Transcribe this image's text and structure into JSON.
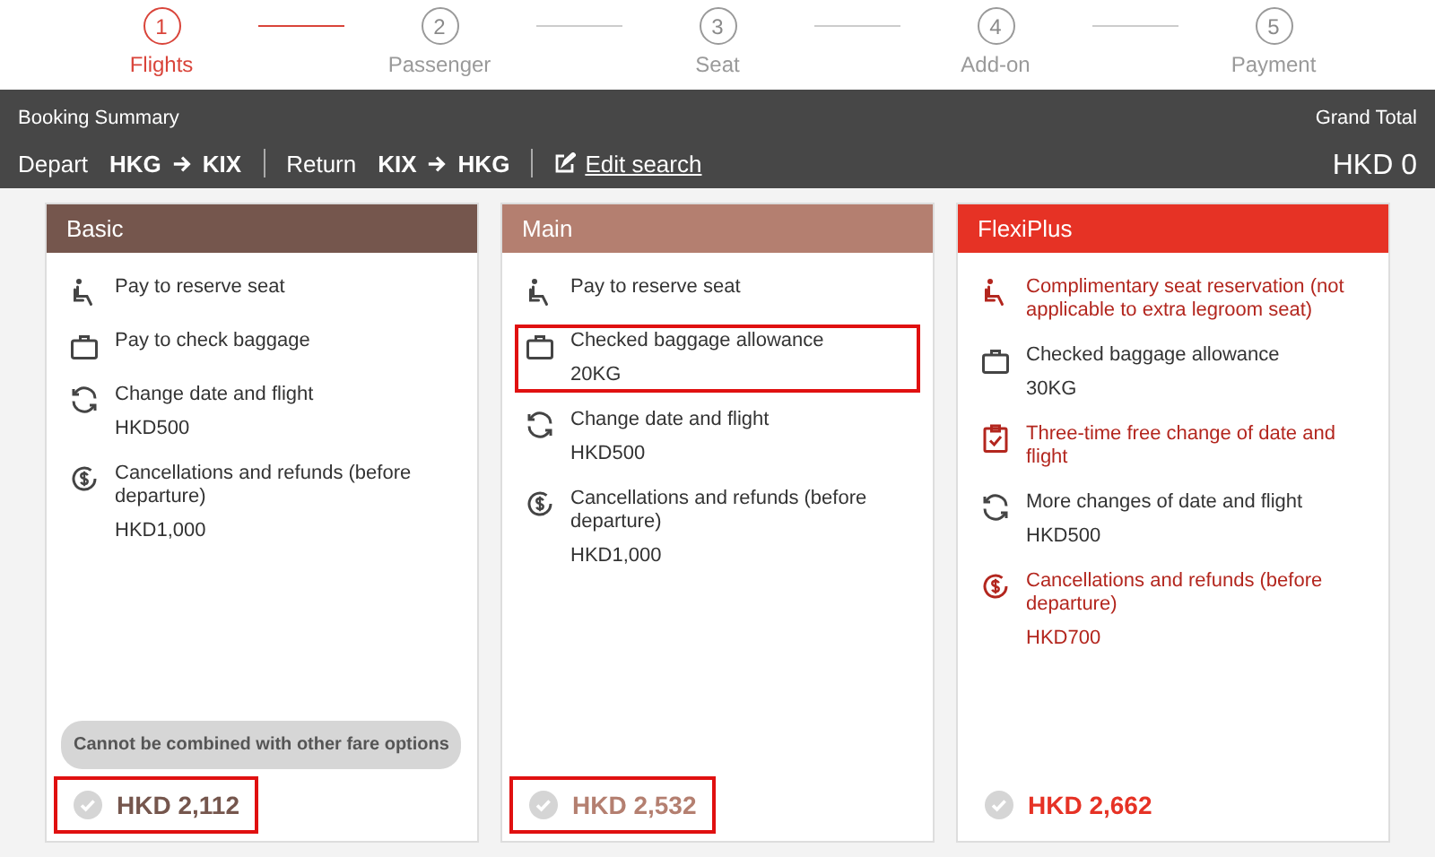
{
  "steps": [
    {
      "number": "1",
      "label": "Flights",
      "selected": true
    },
    {
      "number": "2",
      "label": "Passenger",
      "selected": false
    },
    {
      "number": "3",
      "label": "Seat",
      "selected": false
    },
    {
      "number": "4",
      "label": "Add-on",
      "selected": false
    },
    {
      "number": "5",
      "label": "Payment",
      "selected": false
    }
  ],
  "summary": {
    "title": "Booking Summary",
    "depart_label": "Depart",
    "depart_from": "HKG",
    "depart_to": "KIX",
    "return_label": "Return",
    "return_from": "KIX",
    "return_to": "HKG",
    "edit_link": "Edit search",
    "total_label": "Grand Total",
    "total_value": "HKD 0"
  },
  "fares": [
    {
      "name": "Basic",
      "color": "#75564d",
      "features": [
        {
          "kind": "seat",
          "text": "Pay to reserve seat",
          "emphasized": false,
          "highlighted": false
        },
        {
          "kind": "bag",
          "text": "Pay to check baggage",
          "emphasized": false,
          "highlighted": false
        },
        {
          "kind": "refresh",
          "text": "Change date and flight",
          "detail": "HKD500",
          "emphasized": false,
          "highlighted": false
        },
        {
          "kind": "dollar",
          "text": "Cancellations and refunds (before departure)",
          "detail": "HKD1,000",
          "emphasized": false,
          "highlighted": false
        }
      ],
      "note": "Cannot be combined with other fare options",
      "price": "HKD 2,112",
      "price_highlighted": true
    },
    {
      "name": "Main",
      "color": "#b47f70",
      "features": [
        {
          "kind": "seat",
          "text": "Pay to reserve seat",
          "emphasized": false,
          "highlighted": false
        },
        {
          "kind": "bag",
          "text": "Checked baggage allowance",
          "detail": "20KG",
          "emphasized": false,
          "highlighted": true
        },
        {
          "kind": "refresh",
          "text": "Change date and flight",
          "detail": "HKD500",
          "emphasized": false,
          "highlighted": false
        },
        {
          "kind": "dollar",
          "text": "Cancellations and refunds (before departure)",
          "detail": "HKD1,000",
          "emphasized": false,
          "highlighted": false
        }
      ],
      "price": "HKD 2,532",
      "price_highlighted": true
    },
    {
      "name": "FlexiPlus",
      "color": "#e63225",
      "features": [
        {
          "kind": "seat",
          "text": "Complimentary seat reservation (not applicable to extra legroom seat)",
          "emphasized": true,
          "highlighted": false
        },
        {
          "kind": "bag",
          "text": "Checked baggage allowance",
          "detail": "30KG",
          "emphasized": false,
          "highlighted": false
        },
        {
          "kind": "clipboard",
          "text": "Three-time free change of date and flight",
          "emphasized": true,
          "highlighted": false
        },
        {
          "kind": "refresh",
          "text": "More changes of date and flight",
          "detail": "HKD500",
          "emphasized": false,
          "highlighted": false
        },
        {
          "kind": "dollar",
          "text": "Cancellations and refunds (before departure)",
          "detail": "HKD700",
          "emphasized": true,
          "highlighted": false
        }
      ],
      "price": "HKD 2,662",
      "price_highlighted": false
    }
  ]
}
